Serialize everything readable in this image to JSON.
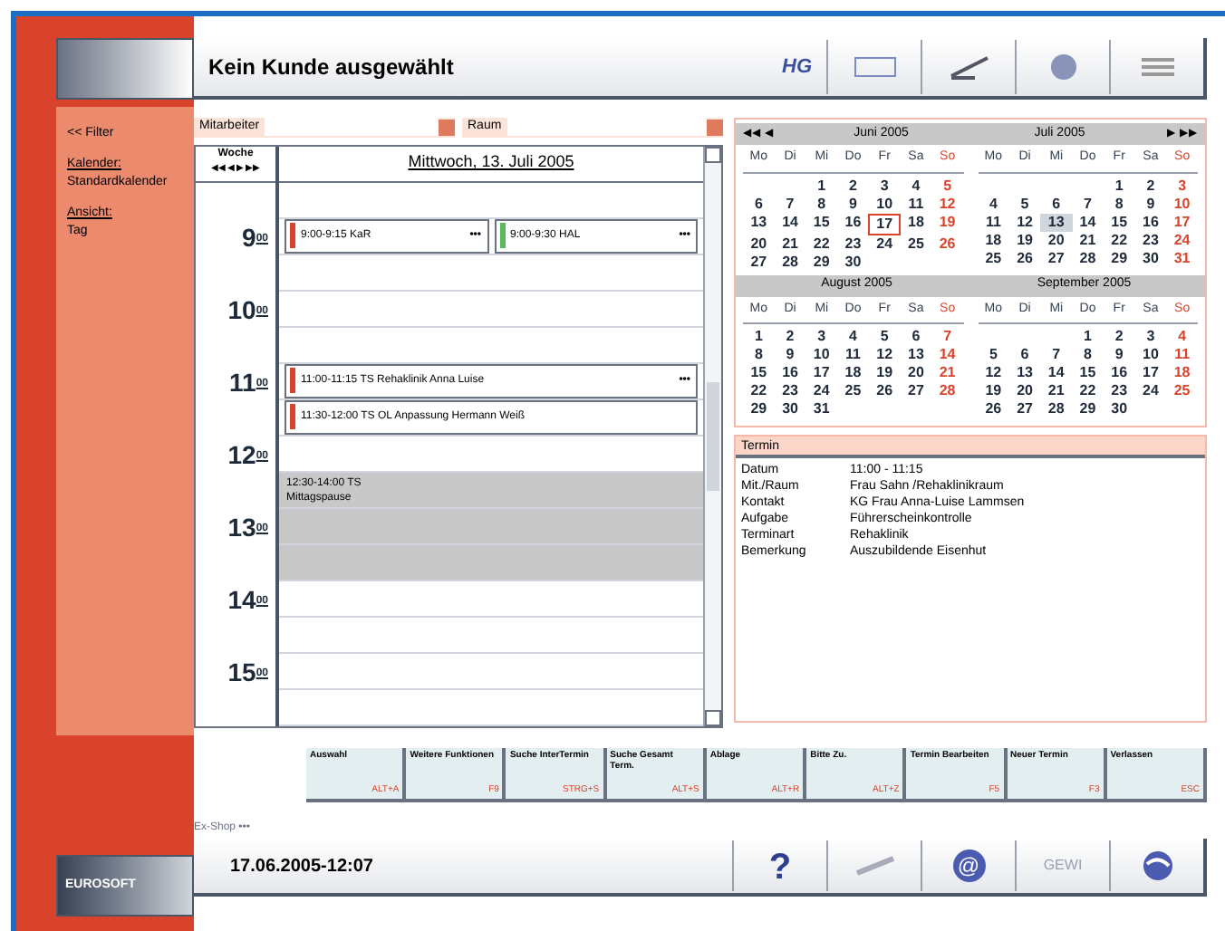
{
  "header": {
    "title": "Kein Kunde ausgewählt",
    "badge": "HG"
  },
  "sidebar": {
    "filter": "<< Filter",
    "items": [
      {
        "label": "Kalender:",
        "value": "Standardkalender"
      },
      {
        "label": "Ansicht:",
        "value": "Tag"
      }
    ]
  },
  "filters": [
    {
      "label": "Mitarbeiter"
    },
    {
      "label": "Raum"
    }
  ],
  "week": {
    "label": "Woche",
    "nav": [
      "◀◀",
      "◀",
      "▶",
      "▶▶"
    ]
  },
  "day_title": "Mittwoch, 13. Juli 2005",
  "slots": [
    {
      "kind": "free"
    },
    {
      "kind": "busy",
      "hour": "9",
      "minutes": "00",
      "entries": [
        {
          "text": "9:00-9:15 KaR",
          "more": "•••",
          "color": "#d9432b"
        },
        {
          "text": "9:00-9:30 HAL",
          "more": "•••",
          "color": "#5cb85c"
        }
      ]
    },
    {
      "kind": "free"
    },
    {
      "kind": "free",
      "hour": "10",
      "minutes": "00"
    },
    {
      "kind": "free"
    },
    {
      "kind": "busy",
      "hour": "11",
      "minutes": "00",
      "entries": [
        {
          "text": "11:00-11:15 TS Rehaklinik Anna Luise",
          "more": "•••",
          "color": "#d9432b"
        }
      ]
    },
    {
      "kind": "busy",
      "entries": [
        {
          "text": "11:30-12:00 TS OL Anpassung Hermann Weiß",
          "color": "#d9432b"
        }
      ]
    },
    {
      "kind": "free",
      "hour": "12",
      "minutes": "00"
    },
    {
      "kind": "busy",
      "entries": [
        {
          "text": "12:30-14:00 TS",
          "note": "Mittagspause",
          "kind": "block"
        }
      ]
    },
    {
      "kind": "continued",
      "hour": "13",
      "minutes": "00"
    },
    {
      "kind": "continued"
    },
    {
      "kind": "free",
      "hour": "14",
      "minutes": "00"
    },
    {
      "kind": "free"
    },
    {
      "kind": "free",
      "hour": "15",
      "minutes": "00"
    },
    {
      "kind": "free"
    }
  ],
  "calendar": {
    "nav_prev": [
      "◀◀",
      "◀"
    ],
    "nav_next": [
      "▶",
      "▶▶"
    ],
    "pairs": [
      {
        "months": [
          {
            "name": "Juni 2005",
            "weekdays": [
              "Mo",
              "Di",
              "Mi",
              "Do",
              "Fr",
              "Sa",
              "So"
            ],
            "weeks": [
              [
                "1",
                "2",
                "3",
                "4",
                "5"
              ],
              [
                "6",
                "7",
                "8",
                "9",
                "10",
                "11",
                "12"
              ],
              [
                "13",
                "14",
                "15",
                "16",
                {
                  "d": "17",
                  "kind": "today"
                },
                "18",
                "19"
              ],
              [
                "20",
                "21",
                "22",
                "23",
                "24",
                "25",
                "26"
              ],
              [
                "27",
                "28",
                "29",
                "30"
              ]
            ]
          },
          {
            "name": "Juli 2005",
            "weekdays": [
              "Mo",
              "Di",
              "Mi",
              "Do",
              "Fr",
              "Sa",
              "So"
            ],
            "weeks": [
              [
                "1",
                "2",
                "3"
              ],
              [
                "4",
                "5",
                "6",
                "7",
                "8",
                "9",
                "10"
              ],
              [
                "11",
                "12",
                {
                  "d": "13",
                  "kind": "selected"
                },
                "14",
                "15",
                "16",
                "17"
              ],
              [
                "18",
                "19",
                "20",
                "21",
                "22",
                "23",
                "24"
              ],
              [
                "25",
                "26",
                "27",
                "28",
                "29",
                "30",
                "31"
              ]
            ]
          }
        ]
      },
      {
        "months": [
          {
            "name": "August 2005",
            "weekdays": [
              "Mo",
              "Di",
              "Mi",
              "Do",
              "Fr",
              "Sa",
              "So"
            ],
            "weeks": [
              [
                "1",
                "2",
                "3",
                "4",
                "5",
                "6",
                "7"
              ],
              [
                "8",
                "9",
                "10",
                "11",
                "12",
                "13",
                "14"
              ],
              [
                "15",
                "16",
                "17",
                "18",
                "19",
                "20",
                "21"
              ],
              [
                "22",
                "23",
                "24",
                "25",
                "26",
                "27",
                "28"
              ],
              [
                "29",
                "30",
                "31"
              ]
            ]
          },
          {
            "name": "September 2005",
            "weekdays": [
              "Mo",
              "Di",
              "Mi",
              "Do",
              "Fr",
              "Sa",
              "So"
            ],
            "weeks": [
              [
                "1",
                "2",
                "3",
                "4"
              ],
              [
                "5",
                "6",
                "7",
                "8",
                "9",
                "10",
                "11"
              ],
              [
                "12",
                "13",
                "14",
                "15",
                "16",
                "17",
                "18"
              ],
              [
                "19",
                "20",
                "21",
                "22",
                "23",
                "24",
                "25"
              ],
              [
                "26",
                "27",
                "28",
                "29",
                "30"
              ]
            ]
          }
        ]
      }
    ]
  },
  "details": {
    "title": "Termin",
    "rows": [
      {
        "label": "Datum",
        "value": "11:00 - 11:15"
      },
      {
        "label": "Mit./Raum",
        "value": "Frau Sahn /Rehaklinikraum"
      },
      {
        "label": "Kontakt",
        "value": "KG Frau Anna-Luise Lammsen"
      },
      {
        "label": "Aufgabe",
        "value": "Führerscheinkontrolle"
      },
      {
        "label": "Terminart",
        "value": "Rehaklinik"
      },
      {
        "label": "Bemerkung",
        "value": "Auszubildende Eisenhut"
      }
    ]
  },
  "function_keys": [
    {
      "label": "Auswahl",
      "key": "ALT+A"
    },
    {
      "label": "Weitere Funktionen",
      "key": "F9"
    },
    {
      "label": "Suche InterTermin",
      "key": "STRG+S"
    },
    {
      "label": "Suche Gesamt Term.",
      "key": "ALT+S"
    },
    {
      "label": "Ablage",
      "key": "ALT+R"
    },
    {
      "label": "Bitte Zu.",
      "key": "ALT+Z"
    },
    {
      "label": "Termin Bearbeiten",
      "key": "F5"
    },
    {
      "label": "Neuer Termin",
      "key": "F3"
    },
    {
      "label": "Verlassen",
      "key": "ESC"
    }
  ],
  "footer": {
    "logo": "EUROSOFT",
    "user": "Ex-Shop •••",
    "timestamp": "17.06.2005-12:07",
    "help": "?",
    "at": "@",
    "code": "GEWI"
  }
}
